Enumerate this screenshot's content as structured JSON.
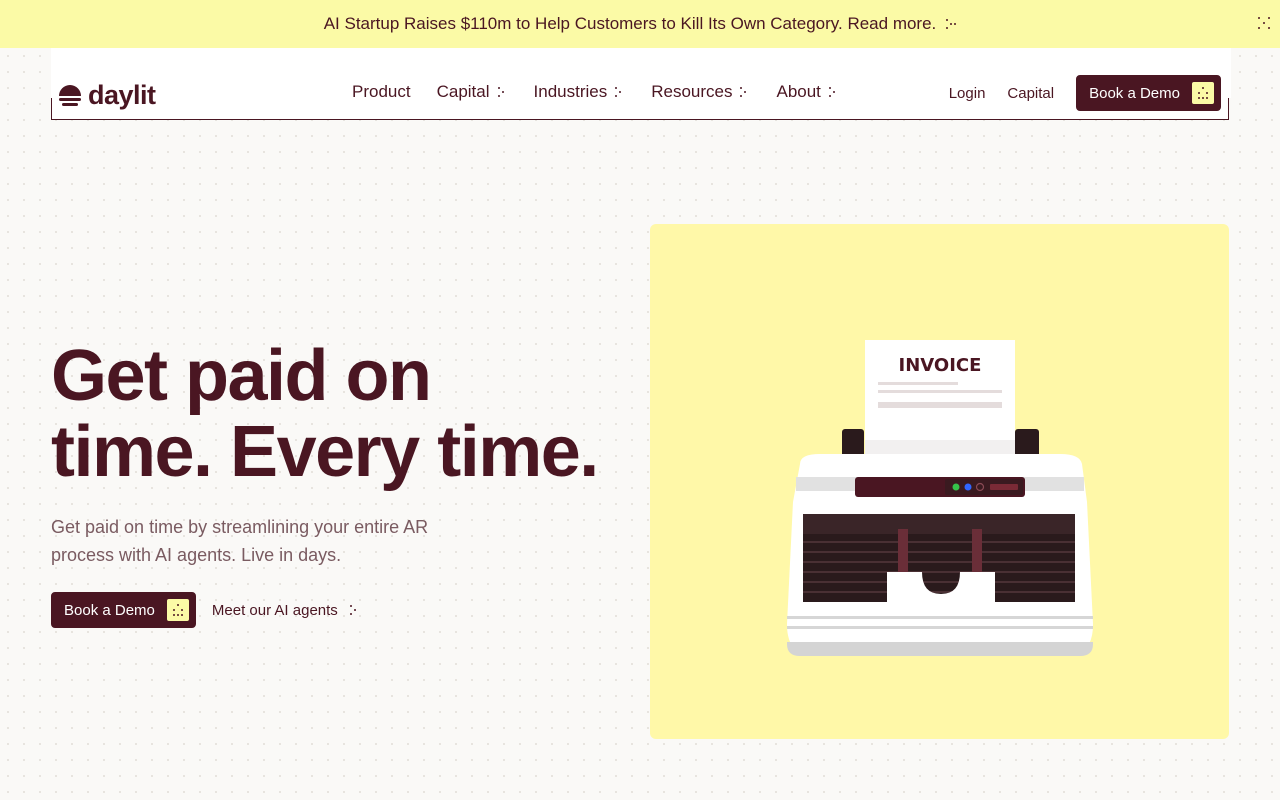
{
  "banner": {
    "text": "AI Startup Raises $110m to Help Customers to Kill Its Own Category. Read more.",
    "close_icon": "close-dots-icon"
  },
  "nav": {
    "logo_text": "daylit",
    "items": [
      {
        "label": "Product",
        "has_menu": false
      },
      {
        "label": "Capital",
        "has_menu": true
      },
      {
        "label": "Industries",
        "has_menu": true
      },
      {
        "label": "Resources",
        "has_menu": true
      },
      {
        "label": "About",
        "has_menu": true
      }
    ],
    "login": "Login",
    "capital": "Capital",
    "cta": "Book a Demo"
  },
  "hero": {
    "title_line1": "Get paid on",
    "title_line2": "time. Every time.",
    "subtitle": "Get paid on time by streamlining your entire AR process with AI agents. Live in days.",
    "primary_cta": "Book a Demo",
    "secondary_cta": "Meet our AI agents",
    "illustration_label": "INVOICE"
  },
  "colors": {
    "brand": "#4a1622",
    "accent_yellow": "#fbfaa6",
    "art_bg": "#fff8a8"
  }
}
